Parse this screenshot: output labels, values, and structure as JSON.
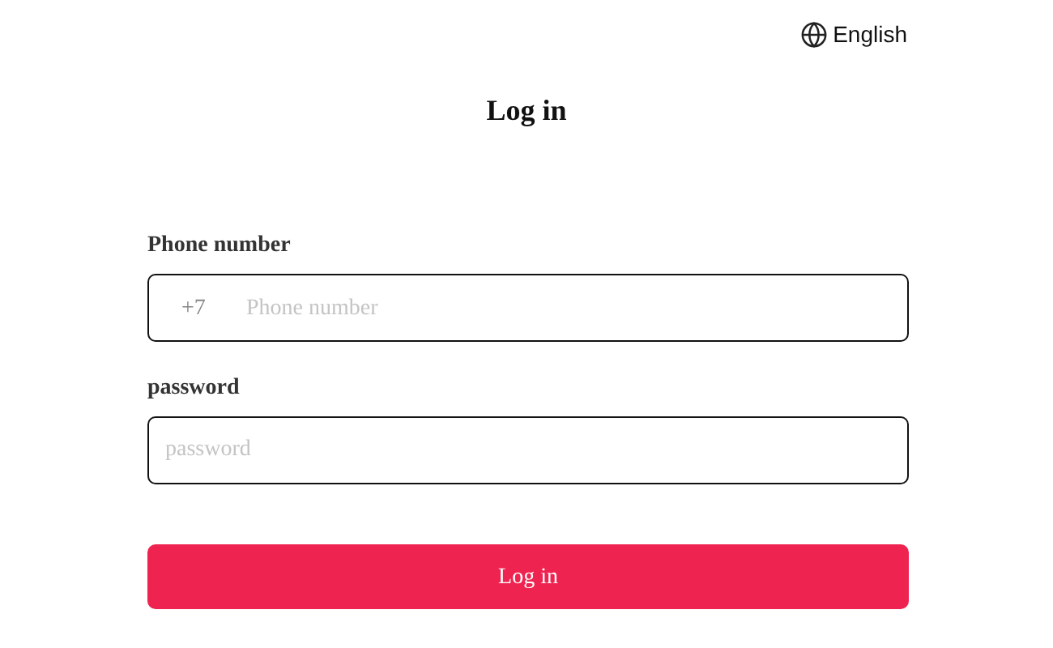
{
  "language": {
    "label": "English"
  },
  "title": "Log in",
  "fields": [
    {
      "kind": "phone",
      "label": "Phone number",
      "prefix": "+7",
      "placeholder": "Phone number"
    },
    {
      "kind": "password",
      "label": "password",
      "placeholder": "password"
    }
  ],
  "submit": {
    "label": "Log in"
  }
}
